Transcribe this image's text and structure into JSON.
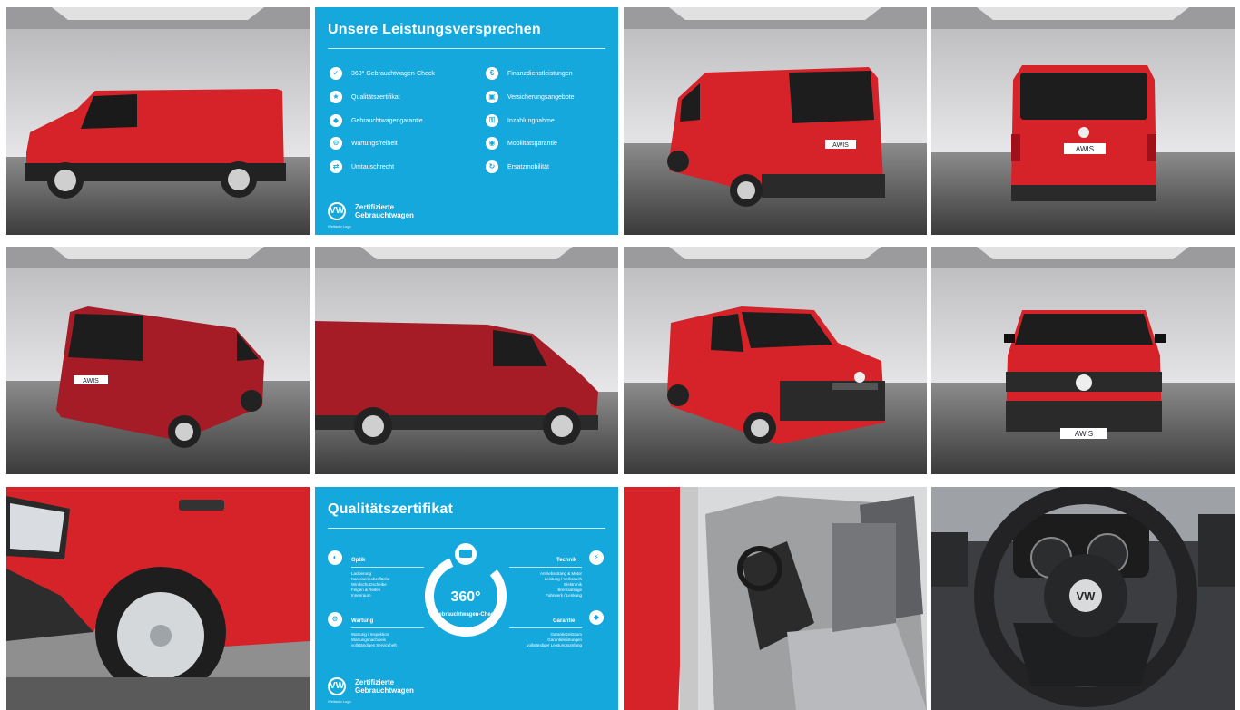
{
  "panel1": {
    "title": "Unsere Leistungsversprechen",
    "left_items": [
      {
        "label": "360° Gebrauchtwagen-Check",
        "icon": "check-icon"
      },
      {
        "label": "Qualitätszertifikat",
        "icon": "certificate-icon"
      },
      {
        "label": "Gebrauchtwagengarantie",
        "icon": "shield-icon"
      },
      {
        "label": "Wartungsfreiheit",
        "icon": "wrench-icon"
      },
      {
        "label": "Umtauschrecht",
        "icon": "exchange-icon"
      }
    ],
    "right_items": [
      {
        "label": "Finanzdienstleistungen",
        "icon": "finance-icon"
      },
      {
        "label": "Versicherungsangebote",
        "icon": "insurance-icon"
      },
      {
        "label": "Inzahlungnahme",
        "icon": "tradein-icon"
      },
      {
        "label": "Mobilitätsgarantie",
        "icon": "car-icon"
      },
      {
        "label": "Ersatzmobilität",
        "icon": "replacement-icon"
      }
    ],
    "brand_line1": "Zertifizierte",
    "brand_line2": "Gebrauchtwagen",
    "brand_sub": "Weltauto Logo"
  },
  "panel2": {
    "title": "Qualitätszertifikat",
    "badge_number": "360°",
    "badge_text": "Gebrauchtwagen-Check",
    "optik": {
      "heading": "Optik",
      "items": [
        "Lackierung",
        "Karosserieoberfläche",
        "Windschutzscheibe",
        "Felgen & Reifen",
        "Innenraum"
      ]
    },
    "wartung": {
      "heading": "Wartung",
      "items": [
        "Wartung / Inspektion",
        "Wartungsnachweis",
        "vollständiges Serviceheft"
      ]
    },
    "technik": {
      "heading": "Technik",
      "items": [
        "Antriebsstrang & Motor",
        "Leistung / Verbrauch",
        "Elektronik",
        "Bremsanlage",
        "Fahrwerk / Lenkung"
      ]
    },
    "garantie": {
      "heading": "Garantie",
      "items": [
        "Garantiezeitraum",
        "Garantieleistungen",
        "vollständiger Leistungsumfang"
      ]
    },
    "brand_line1": "Zertifizierte",
    "brand_line2": "Gebrauchtwagen",
    "brand_sub": "Weltauto Logo"
  },
  "plates": {
    "text": "AWIS"
  },
  "badges": {
    "vw": "VW"
  },
  "colors": {
    "van_red": "#d6232a",
    "panel_blue": "#14a8dd"
  }
}
